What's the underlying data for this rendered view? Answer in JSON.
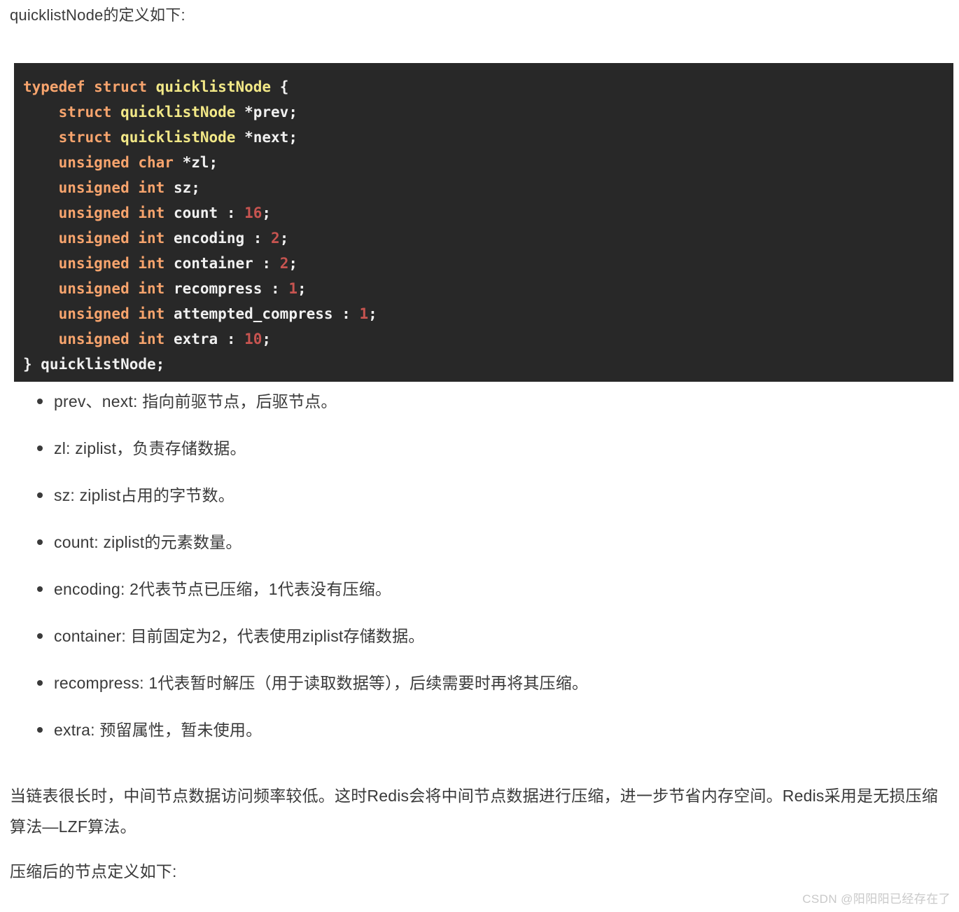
{
  "intro": {
    "text": "quicklistNode的定义如下:"
  },
  "code": {
    "language": "c",
    "lines": [
      [
        {
          "t": "typedef ",
          "c": "kw"
        },
        {
          "t": "struct ",
          "c": "kw"
        },
        {
          "t": "quicklistNode",
          "c": "type"
        },
        {
          "t": " {",
          "c": "plain"
        }
      ],
      [
        {
          "t": "    ",
          "c": "plain"
        },
        {
          "t": "struct ",
          "c": "kw"
        },
        {
          "t": "quicklistNode",
          "c": "type"
        },
        {
          "t": " *prev;",
          "c": "plain"
        }
      ],
      [
        {
          "t": "    ",
          "c": "plain"
        },
        {
          "t": "struct ",
          "c": "kw"
        },
        {
          "t": "quicklistNode",
          "c": "type"
        },
        {
          "t": " *next;",
          "c": "plain"
        }
      ],
      [
        {
          "t": "    ",
          "c": "plain"
        },
        {
          "t": "unsigned ",
          "c": "kw"
        },
        {
          "t": "char",
          "c": "kw"
        },
        {
          "t": " *zl;",
          "c": "plain"
        }
      ],
      [
        {
          "t": "    ",
          "c": "plain"
        },
        {
          "t": "unsigned ",
          "c": "kw"
        },
        {
          "t": "int",
          "c": "kw"
        },
        {
          "t": " sz;",
          "c": "plain"
        }
      ],
      [
        {
          "t": "    ",
          "c": "plain"
        },
        {
          "t": "unsigned ",
          "c": "kw"
        },
        {
          "t": "int",
          "c": "kw"
        },
        {
          "t": " count : ",
          "c": "plain"
        },
        {
          "t": "16",
          "c": "num"
        },
        {
          "t": ";",
          "c": "plain"
        }
      ],
      [
        {
          "t": "    ",
          "c": "plain"
        },
        {
          "t": "unsigned ",
          "c": "kw"
        },
        {
          "t": "int",
          "c": "kw"
        },
        {
          "t": " encoding : ",
          "c": "plain"
        },
        {
          "t": "2",
          "c": "num"
        },
        {
          "t": ";",
          "c": "plain"
        }
      ],
      [
        {
          "t": "    ",
          "c": "plain"
        },
        {
          "t": "unsigned ",
          "c": "kw"
        },
        {
          "t": "int",
          "c": "kw"
        },
        {
          "t": " container : ",
          "c": "plain"
        },
        {
          "t": "2",
          "c": "num"
        },
        {
          "t": ";",
          "c": "plain"
        }
      ],
      [
        {
          "t": "    ",
          "c": "plain"
        },
        {
          "t": "unsigned ",
          "c": "kw"
        },
        {
          "t": "int",
          "c": "kw"
        },
        {
          "t": " recompress : ",
          "c": "plain"
        },
        {
          "t": "1",
          "c": "num"
        },
        {
          "t": ";",
          "c": "plain"
        }
      ],
      [
        {
          "t": "    ",
          "c": "plain"
        },
        {
          "t": "unsigned ",
          "c": "kw"
        },
        {
          "t": "int",
          "c": "kw"
        },
        {
          "t": " attempted_compress : ",
          "c": "plain"
        },
        {
          "t": "1",
          "c": "num"
        },
        {
          "t": ";",
          "c": "plain"
        }
      ],
      [
        {
          "t": "    ",
          "c": "plain"
        },
        {
          "t": "unsigned ",
          "c": "kw"
        },
        {
          "t": "int",
          "c": "kw"
        },
        {
          "t": " extra : ",
          "c": "plain"
        },
        {
          "t": "10",
          "c": "num"
        },
        {
          "t": ";",
          "c": "plain"
        }
      ],
      [
        {
          "t": "} quicklistNode;",
          "c": "plain"
        }
      ]
    ],
    "colors": {
      "background": "#282828",
      "keyword": "#f7a46d",
      "type": "#f2e887",
      "number": "#c75450",
      "plain": "#f0f0f0"
    }
  },
  "bullets": [
    {
      "text": "prev、next: 指向前驱节点，后驱节点。"
    },
    {
      "text": "zl: ziplist，负责存储数据。"
    },
    {
      "text": "sz: ziplist占用的字节数。"
    },
    {
      "text": "count: ziplist的元素数量。"
    },
    {
      "text": "encoding: 2代表节点已压缩，1代表没有压缩。"
    },
    {
      "text": "container: 目前固定为2，代表使用ziplist存储数据。"
    },
    {
      "text": "recompress: 1代表暂时解压（用于读取数据等），后续需要时再将其压缩。"
    },
    {
      "text": "extra: 预留属性，暂未使用。"
    }
  ],
  "paragraphs": {
    "p1": "当链表很长时，中间节点数据访问频率较低。这时Redis会将中间节点数据进行压缩，进一步节省内存空间。Redis采用是无损压缩算法—LZF算法。",
    "p2": "压缩后的节点定义如下:"
  },
  "watermark": {
    "text": "CSDN @阳阳阳已经存在了"
  }
}
